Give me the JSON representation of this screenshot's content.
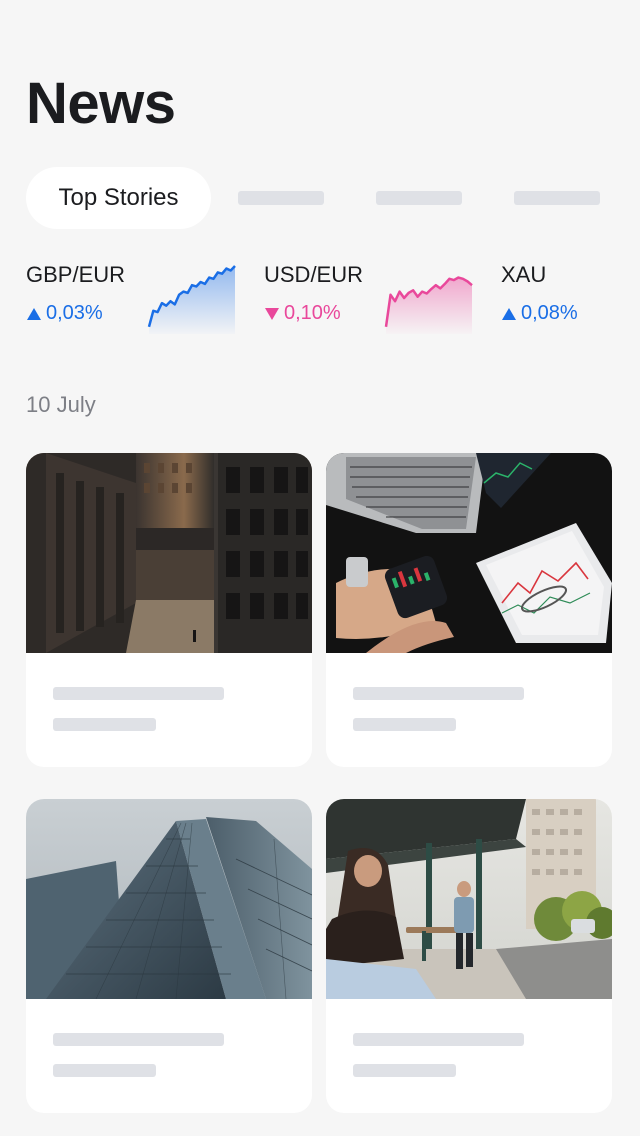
{
  "header": {
    "title": "News"
  },
  "tabs": [
    {
      "label": "Top Stories",
      "active": true
    },
    {
      "label": "",
      "active": false
    },
    {
      "label": "",
      "active": false
    },
    {
      "label": "",
      "active": false
    }
  ],
  "tickers": [
    {
      "name": "GBP/EUR",
      "change": "0,03%",
      "direction": "up",
      "color": "#1a6ee6",
      "spark": [
        0.05,
        0.3,
        0.28,
        0.42,
        0.38,
        0.45,
        0.4,
        0.55,
        0.6,
        0.58,
        0.7,
        0.68,
        0.75,
        0.72,
        0.82,
        0.8,
        0.9,
        0.88,
        0.96,
        0.93,
        1.0
      ]
    },
    {
      "name": "USD/EUR",
      "change": "0,10%",
      "direction": "down",
      "color": "#e9489b",
      "spark": [
        0.05,
        0.55,
        0.45,
        0.6,
        0.5,
        0.58,
        0.62,
        0.52,
        0.6,
        0.57,
        0.64,
        0.7,
        0.65,
        0.72,
        0.8,
        0.78,
        0.82,
        0.8,
        0.76,
        0.7
      ]
    },
    {
      "name": "XAU",
      "change": "0,08%",
      "direction": "up",
      "color": "#1a6ee6",
      "spark": []
    }
  ],
  "section": {
    "date": "10 July"
  },
  "cards": [
    {
      "image": "city-street-photo-icon"
    },
    {
      "image": "trading-desk-photo-icon"
    },
    {
      "image": "glass-skyscraper-photo-icon"
    },
    {
      "image": "bus-stop-photo-icon"
    }
  ]
}
